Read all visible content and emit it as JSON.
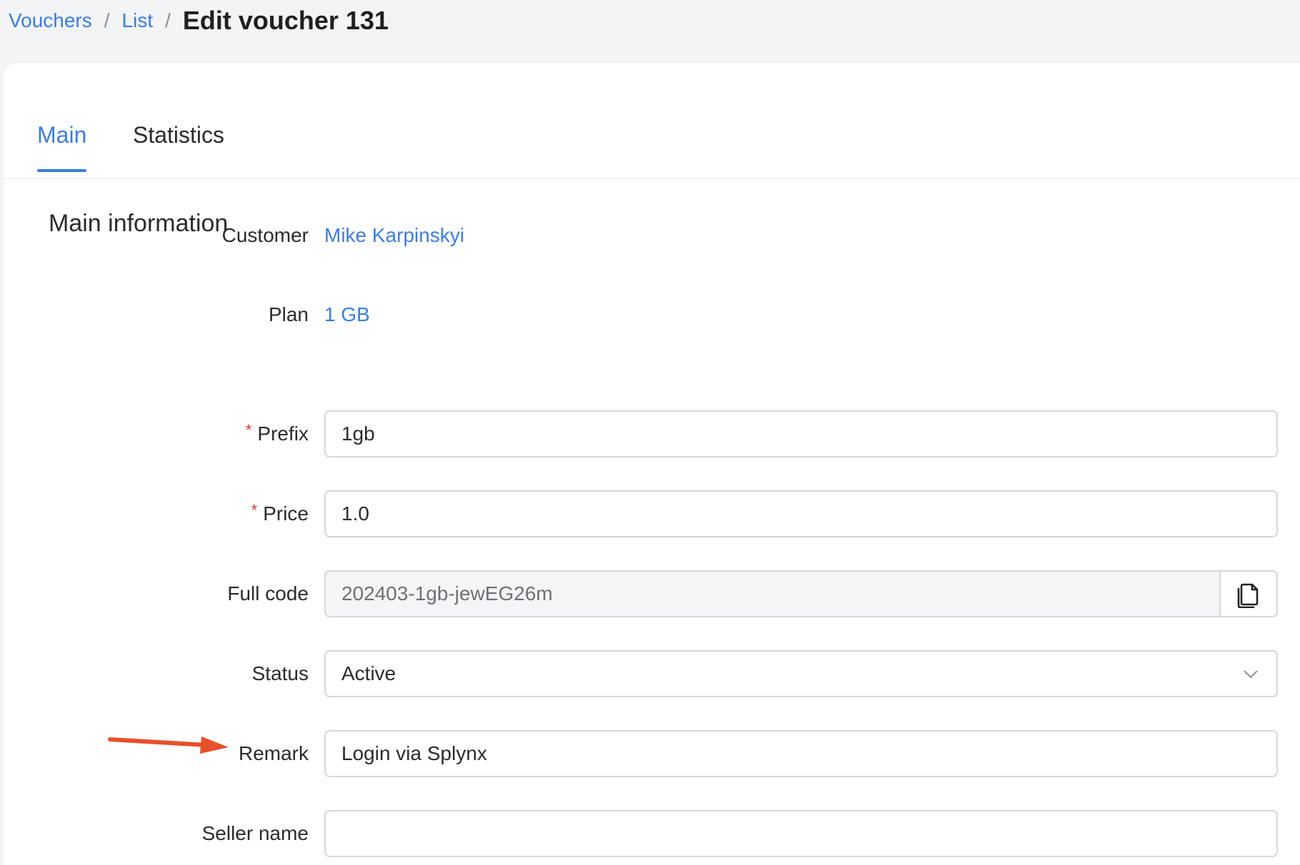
{
  "breadcrumb": {
    "items": [
      "Vouchers",
      "List"
    ],
    "separator": "/",
    "current": "Edit voucher 131"
  },
  "tabs": {
    "main": "Main",
    "statistics": "Statistics",
    "active": "Main"
  },
  "section": {
    "title": "Main information"
  },
  "form": {
    "customer": {
      "label": "Customer",
      "value": "Mike Karpinskyi"
    },
    "plan": {
      "label": "Plan",
      "value": "1 GB"
    },
    "prefix": {
      "label": "Prefix",
      "required_mark": "*",
      "value": "1gb"
    },
    "price": {
      "label": "Price",
      "required_mark": "*",
      "value": "1.0"
    },
    "full_code": {
      "label": "Full code",
      "value": "202403-1gb-jewEG26m",
      "copy_icon": "copy-icon"
    },
    "status": {
      "label": "Status",
      "value": "Active",
      "icon": "chevron-down-icon"
    },
    "remark": {
      "label": "Remark",
      "value": "Login via Splynx"
    },
    "seller_name": {
      "label": "Seller name",
      "value": ""
    }
  },
  "annotation": {
    "icon": "arrow-right-icon",
    "color": "#e8502a"
  },
  "colors": {
    "accent": "#3b7ddd",
    "required": "#e5322d",
    "background": "#f3f4f6"
  }
}
